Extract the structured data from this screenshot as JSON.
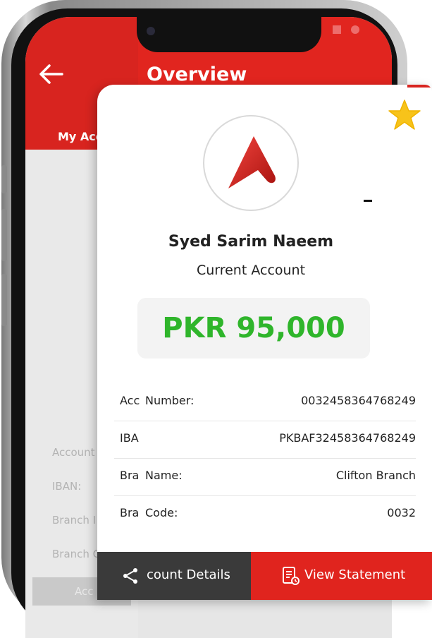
{
  "header": {
    "title": "Overview",
    "tab_label": "My Acc"
  },
  "background_rows": [
    "Account",
    "IBAN:",
    "Branch I",
    "Branch C"
  ],
  "background_button": "Acc",
  "card": {
    "name": "Syed Sarim Naeem",
    "account_type": "Current Account",
    "balance": "PKR 95,000",
    "details": [
      {
        "label_cut": "Acc",
        "label": "Number:",
        "value": "0032458364768249"
      },
      {
        "label_cut": "IBA",
        "label": "",
        "value": "PKBAF32458364768249"
      },
      {
        "label_cut": "Bra",
        "label": "Name:",
        "value": "Clifton Branch"
      },
      {
        "label_cut": "Bra",
        "label": "Code:",
        "value": "0032"
      }
    ],
    "details_button": "count Details",
    "statement_button": "View Statement"
  },
  "colors": {
    "brand_red": "#e0241e",
    "balance_green": "#2fb52b",
    "star_yellow": "#f7c31a",
    "dark_button": "#3a3a3a"
  },
  "icons": {
    "back": "arrow-left-icon",
    "star": "star-icon",
    "share": "share-icon",
    "statement": "document-icon"
  }
}
